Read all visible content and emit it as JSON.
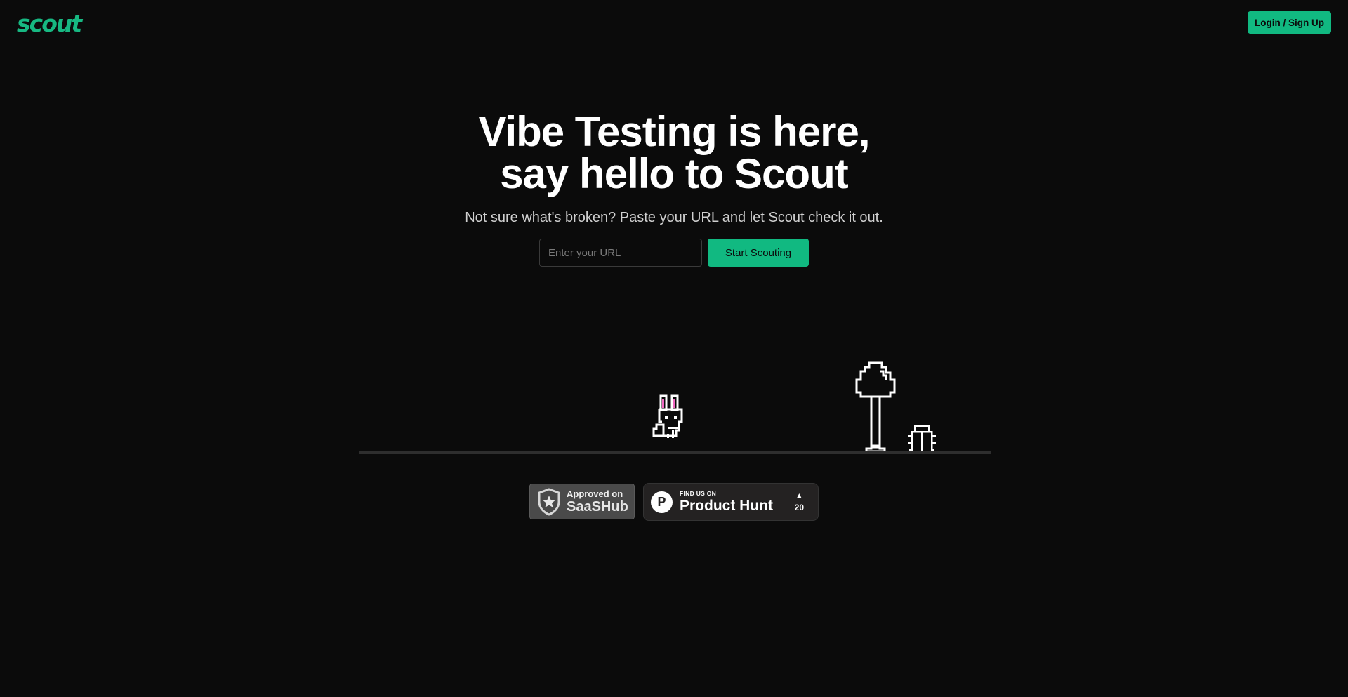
{
  "brand": {
    "logo_text": "scout",
    "accent_color": "#11b981"
  },
  "header": {
    "login_label": "Login / Sign Up"
  },
  "hero": {
    "title_line1": "Vibe Testing is here,",
    "title_line2": "say hello to Scout",
    "subtitle": "Not sure what's broken? Paste your URL and let Scout check it out."
  },
  "url_form": {
    "input_placeholder": "Enter your URL",
    "input_value": "",
    "submit_label": "Start Scouting"
  },
  "scene": {
    "characters": [
      "bunny-icon",
      "tree-icon",
      "bug-icon"
    ]
  },
  "badges": {
    "saashub": {
      "small": "Approved on",
      "big": "SaaSHub",
      "icon": "shield-star-icon"
    },
    "producthunt": {
      "letter": "P",
      "small": "FIND US ON",
      "big": "Product Hunt",
      "arrow": "▲",
      "votes": "20"
    }
  }
}
